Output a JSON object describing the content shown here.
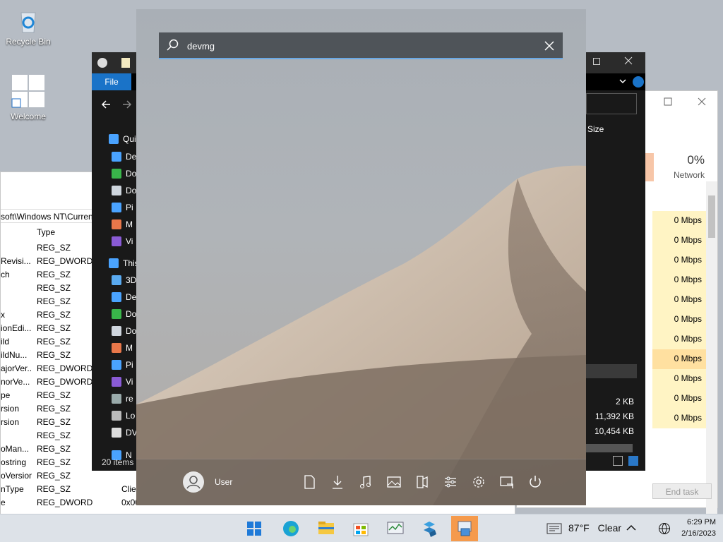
{
  "desktop": {
    "icons": [
      {
        "label": "Recycle Bin"
      },
      {
        "label": "Welcome"
      }
    ]
  },
  "regedit": {
    "address": "soft\\Windows NT\\Curren",
    "col_type": "Type",
    "rows": [
      {
        "name": "",
        "type": "REG_SZ",
        "data": ""
      },
      {
        "name": "Revisi...",
        "type": "REG_DWORD",
        "data": ""
      },
      {
        "name": "ch",
        "type": "REG_SZ",
        "data": ""
      },
      {
        "name": "",
        "type": "REG_SZ",
        "data": ""
      },
      {
        "name": "",
        "type": "REG_SZ",
        "data": ""
      },
      {
        "name": "x",
        "type": "REG_SZ",
        "data": ""
      },
      {
        "name": "ionEdi...",
        "type": "REG_SZ",
        "data": ""
      },
      {
        "name": "ild",
        "type": "REG_SZ",
        "data": ""
      },
      {
        "name": "ildNu...",
        "type": "REG_SZ",
        "data": ""
      },
      {
        "name": "ajorVer...",
        "type": "REG_DWORD",
        "data": ""
      },
      {
        "name": "norVe...",
        "type": "REG_DWORD",
        "data": ""
      },
      {
        "name": "pe",
        "type": "REG_SZ",
        "data": ""
      },
      {
        "name": "rsion",
        "type": "REG_SZ",
        "data": ""
      },
      {
        "name": "rsion",
        "type": "REG_SZ",
        "data": ""
      },
      {
        "name": "",
        "type": "REG_SZ",
        "data": ""
      },
      {
        "name": "oMan...",
        "type": "REG_SZ",
        "data": ""
      },
      {
        "name": "ostring",
        "type": "REG_SZ",
        "data": ""
      },
      {
        "name": "oVersion",
        "type": "REG_SZ",
        "data": ""
      },
      {
        "name": "nType",
        "type": "REG_SZ",
        "data": "Clie"
      },
      {
        "name": "e",
        "type": "REG_DWORD",
        "data": "0x00"
      }
    ]
  },
  "taskmgr": {
    "network_pct": "0%",
    "network_label": "Network",
    "rows": [
      "0 Mbps",
      "0 Mbps",
      "0 Mbps",
      "0 Mbps",
      "0 Mbps",
      "0 Mbps",
      "0 Mbps",
      "0 Mbps",
      "0 Mbps",
      "0 Mbps",
      "0 Mbps"
    ],
    "end_task": "End task"
  },
  "explorer": {
    "file_tab": "File",
    "size_col": "Size",
    "nav": [
      "Qui",
      "De",
      "Do",
      "Do",
      "Pi",
      "M",
      "Vi",
      "This",
      "3D",
      "De",
      "Do",
      "Do",
      "M",
      "Pi",
      "Vi",
      "re",
      "Lo",
      "DV",
      "N"
    ],
    "status": "20 items",
    "sizes": [
      "2 KB",
      "11,392 KB",
      "10,454 KB"
    ]
  },
  "start": {
    "search_value": "devmg",
    "user_name": "User"
  },
  "taskbar": {
    "temperature": "87°F",
    "weather": "Clear",
    "time": "6:29 PM",
    "date": "2/16/2023"
  }
}
